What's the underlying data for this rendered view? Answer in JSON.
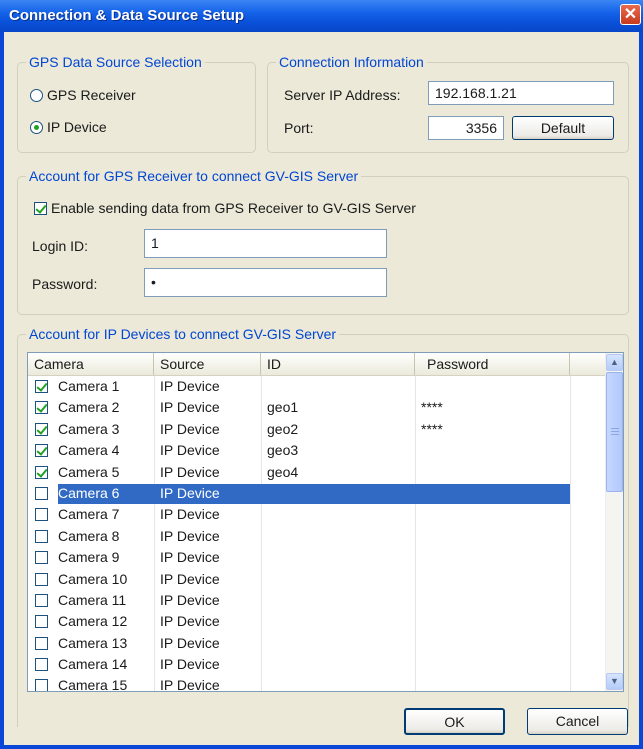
{
  "window": {
    "title": "Connection & Data Source Setup"
  },
  "gps_source": {
    "legend": "GPS Data Source Selection",
    "options": [
      "GPS Receiver",
      "IP Device"
    ],
    "selected": "IP Device"
  },
  "connection": {
    "legend": "Connection Information",
    "server_ip_label": "Server IP Address:",
    "server_ip_value": "192.168.1.21",
    "port_label": "Port:",
    "port_value": "3356",
    "default_button": "Default"
  },
  "gps_account": {
    "legend": "Account for GPS Receiver to connect GV-GIS Server",
    "enable_label": "Enable sending data from GPS Receiver to GV-GIS Server",
    "enable_checked": true,
    "login_label": "Login ID:",
    "login_value": "1",
    "password_label": "Password:",
    "password_value": "•"
  },
  "ip_accounts": {
    "legend": "Account for IP Devices to connect GV-GIS Server",
    "columns": [
      "Camera",
      "Source",
      "ID",
      "Password"
    ],
    "rows": [
      {
        "camera": "Camera 1",
        "source": "IP Device",
        "id": "",
        "password": "",
        "checked": true
      },
      {
        "camera": "Camera 2",
        "source": "IP Device",
        "id": "geo1",
        "password": "****",
        "checked": true
      },
      {
        "camera": "Camera 3",
        "source": "IP Device",
        "id": "geo2",
        "password": "****",
        "checked": true
      },
      {
        "camera": "Camera 4",
        "source": "IP Device",
        "id": "geo3",
        "password": "",
        "checked": true
      },
      {
        "camera": "Camera 5",
        "source": "IP Device",
        "id": "geo4",
        "password": "",
        "checked": true
      },
      {
        "camera": "Camera 6",
        "source": "IP Device",
        "id": "",
        "password": "",
        "checked": false,
        "selected": true
      },
      {
        "camera": "Camera 7",
        "source": "IP Device",
        "id": "",
        "password": "",
        "checked": false
      },
      {
        "camera": "Camera 8",
        "source": "IP Device",
        "id": "",
        "password": "",
        "checked": false
      },
      {
        "camera": "Camera 9",
        "source": "IP Device",
        "id": "",
        "password": "",
        "checked": false
      },
      {
        "camera": "Camera 10",
        "source": "IP Device",
        "id": "",
        "password": "",
        "checked": false
      },
      {
        "camera": "Camera 11",
        "source": "IP Device",
        "id": "",
        "password": "",
        "checked": false
      },
      {
        "camera": "Camera 12",
        "source": "IP Device",
        "id": "",
        "password": "",
        "checked": false
      },
      {
        "camera": "Camera 13",
        "source": "IP Device",
        "id": "",
        "password": "",
        "checked": false
      },
      {
        "camera": "Camera 14",
        "source": "IP Device",
        "id": "",
        "password": "",
        "checked": false
      },
      {
        "camera": "Camera 15",
        "source": "IP Device",
        "id": "",
        "password": "",
        "checked": false
      }
    ]
  },
  "footer": {
    "ok": "OK",
    "cancel": "Cancel"
  },
  "colors": {
    "titlebar": "#0a50d9",
    "legend": "#0046d5",
    "selection": "#316ac5",
    "check": "#21a121"
  }
}
